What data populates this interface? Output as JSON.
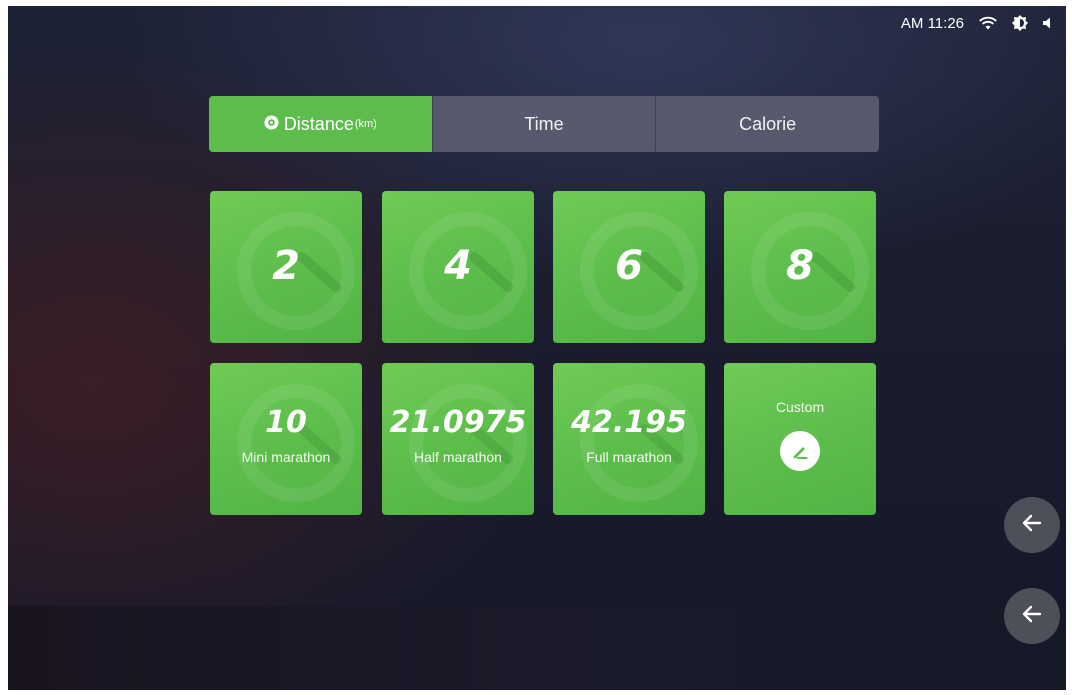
{
  "status_bar": {
    "time": "AM 11:26",
    "icons": [
      "wifi-icon",
      "brightness-icon",
      "volume-icon"
    ]
  },
  "tabs": [
    {
      "label": "Distance",
      "unit": "(km)",
      "active": true,
      "icon": "target-icon"
    },
    {
      "label": "Time",
      "active": false
    },
    {
      "label": "Calorie",
      "active": false
    }
  ],
  "presets": [
    {
      "value": "2"
    },
    {
      "value": "4"
    },
    {
      "value": "6"
    },
    {
      "value": "8"
    },
    {
      "value": "10",
      "label": "Mini marathon"
    },
    {
      "value": "21.0975",
      "label": "Half marathon"
    },
    {
      "value": "42.195",
      "label": "Full marathon"
    }
  ],
  "custom": {
    "label": "Custom",
    "icon": "edit-pencil-icon"
  },
  "back_icon": "arrow-left-icon",
  "colors": {
    "accent": "#5cbd4d",
    "tab_bg": "#5f6273",
    "background": "#1b1d2e"
  }
}
